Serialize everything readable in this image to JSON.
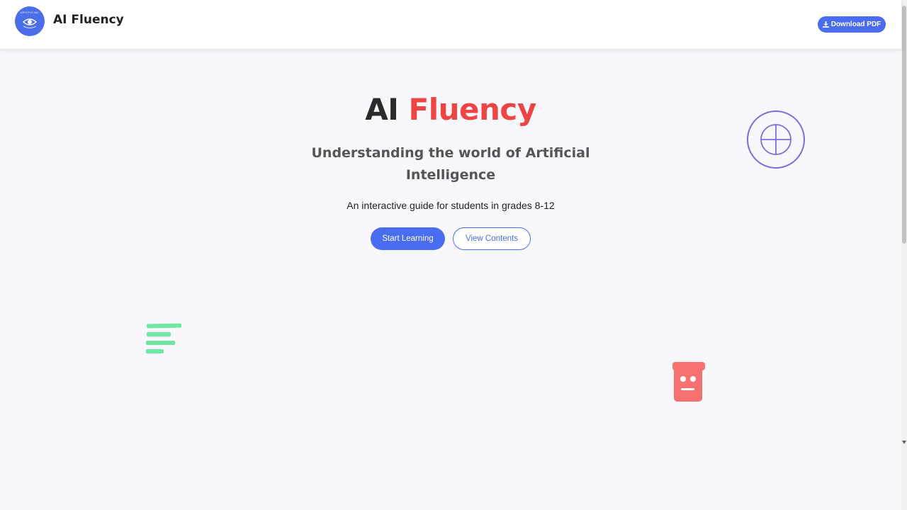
{
  "header": {
    "logo_text": "ARTIFICIAL",
    "brand": "AI Fluency",
    "download_label": "Download PDF"
  },
  "hero": {
    "title_part1": "AI",
    "title_part2": "Fluency",
    "subtitle": "Understanding the world of Artificial Intelligence",
    "description": "An interactive guide for students in grades 8-12",
    "primary_button": "Start Learning",
    "secondary_button": "View Contents"
  },
  "decorations": {
    "globe_icon": "globe-icon",
    "text_lines_icon": "text-lines-icon",
    "robot_icon": "robot-icon"
  },
  "colors": {
    "accent": "#4a6cf0",
    "highlight": "#ef4444",
    "background": "#f7f7fc",
    "globe": "#7b6ee0",
    "lines": "#6ee7a0",
    "robot": "#f87171"
  }
}
